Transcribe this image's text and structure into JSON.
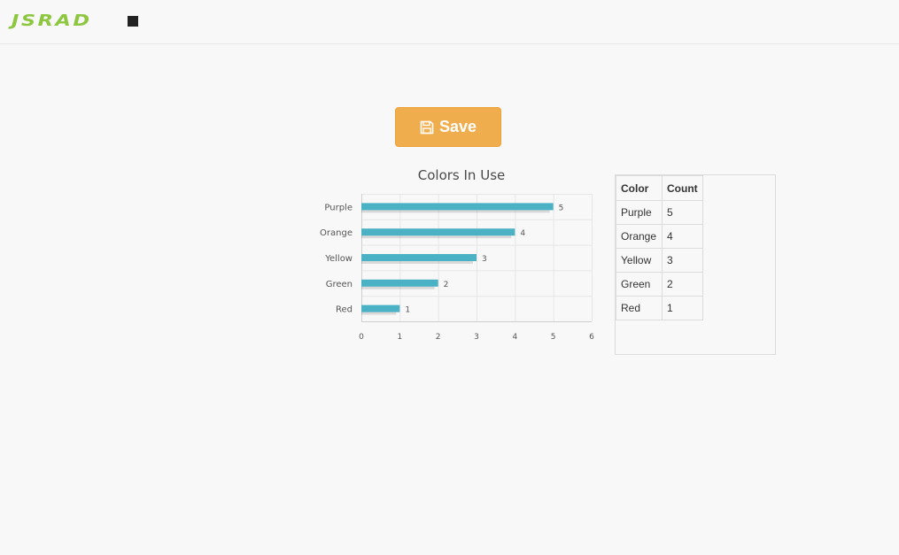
{
  "header": {
    "logo_text": "JSRAD",
    "menu_icon": "square-icon"
  },
  "toolbar": {
    "save_label": "Save",
    "save_icon": "floppy-disk-icon"
  },
  "chart_data": {
    "type": "bar",
    "orientation": "horizontal",
    "title": "Colors In Use",
    "categories": [
      "Purple",
      "Orange",
      "Yellow",
      "Green",
      "Red"
    ],
    "values": [
      5,
      4,
      3,
      2,
      1
    ],
    "xticks": [
      "0",
      "1",
      "2",
      "3",
      "4",
      "5",
      "6"
    ],
    "xlim": [
      0,
      6
    ],
    "grid": true,
    "data_labels": true,
    "bar_color": "#4bb1c5"
  },
  "table": {
    "headers": [
      "Color",
      "Count"
    ],
    "rows": [
      [
        "Purple",
        "5"
      ],
      [
        "Orange",
        "4"
      ],
      [
        "Yellow",
        "3"
      ],
      [
        "Green",
        "2"
      ],
      [
        "Red",
        "1"
      ]
    ]
  }
}
